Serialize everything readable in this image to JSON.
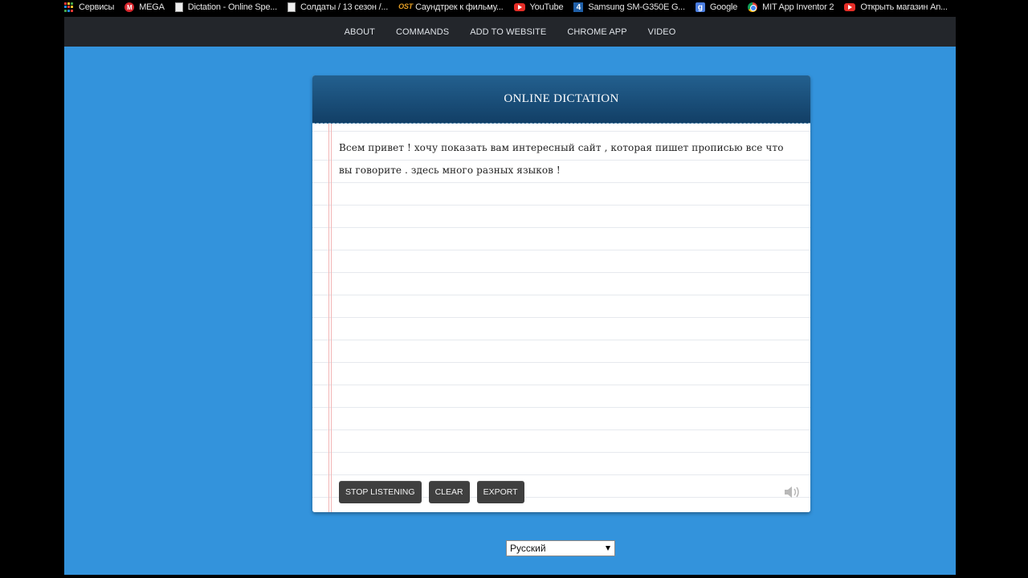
{
  "bookmarks": [
    {
      "label": "Сервисы",
      "icon": "apps-icon"
    },
    {
      "label": "MEGA",
      "icon": "mega-icon"
    },
    {
      "label": "Dictation - Online Spe...",
      "icon": "page-icon"
    },
    {
      "label": "Солдаты / 13 сезон /...",
      "icon": "page-icon"
    },
    {
      "label": "Саундтрек к фильму...",
      "icon": "ost-icon",
      "icon_text": "OST"
    },
    {
      "label": "YouTube",
      "icon": "youtube-icon"
    },
    {
      "label": "Samsung SM-G350E G...",
      "icon": "samsung-icon",
      "icon_text": "4"
    },
    {
      "label": "Google",
      "icon": "google-icon",
      "icon_text": "g"
    },
    {
      "label": "MIT App Inventor 2",
      "icon": "chrome-icon"
    },
    {
      "label": "Открыть магазин An...",
      "icon": "youtube-icon"
    }
  ],
  "nav": [
    "ABOUT",
    "COMMANDS",
    "ADD TO WEBSITE",
    "CHROME APP",
    "VIDEO"
  ],
  "notepad": {
    "title": "ONLINE DICTATION",
    "text": "Всем привет ! хочу показать вам интересный сайт , которая пишет прописью все что вы говорите . здесь много разных языков !",
    "buttons": {
      "stop": "STOP LISTENING",
      "clear": "CLEAR",
      "export": "EXPORT"
    },
    "speaker_icon": "speaker-icon"
  },
  "language": {
    "selected": "Русский"
  },
  "colors": {
    "page_bg": "#3393dc",
    "navbar": "#23262b",
    "header": "#1a4f7c"
  }
}
